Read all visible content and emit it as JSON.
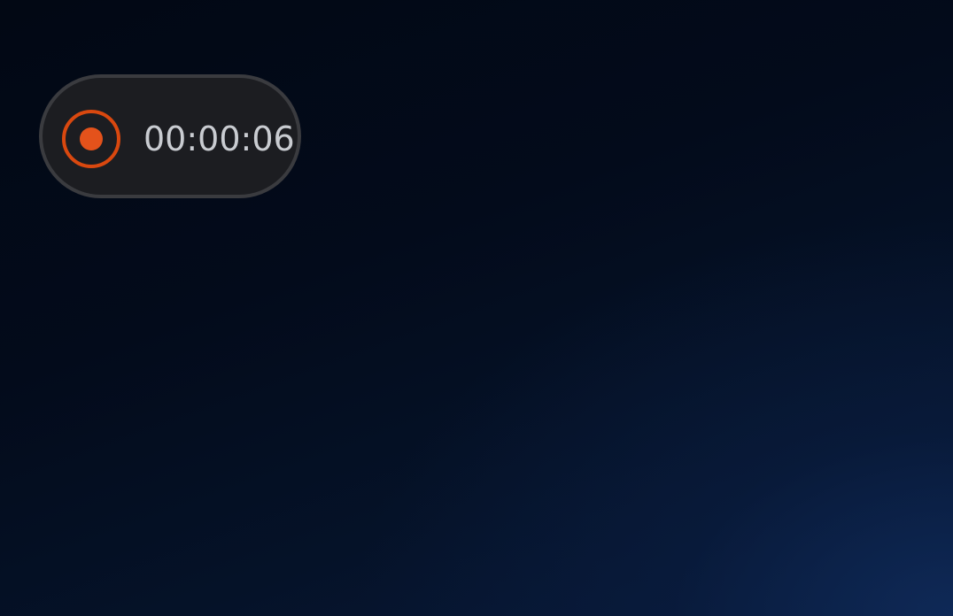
{
  "recorder": {
    "elapsed_time": "00:00:06",
    "record_icon": "record-icon",
    "accent_color": "#d9480f",
    "status": "recording"
  }
}
